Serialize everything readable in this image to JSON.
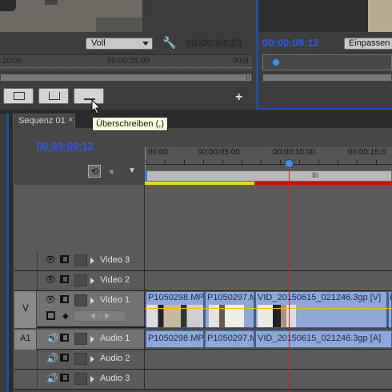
{
  "source_monitor": {
    "zoom_select": "Voll",
    "timecode": "00:00:04:23",
    "ruler_labels": [
      ":20:00",
      "00:00:25:00",
      "00:0"
    ]
  },
  "program_monitor": {
    "timecode": "00:00:09:12",
    "fit_select": "Einpassen"
  },
  "tooltip": "Überschreiben (,)",
  "sequence": {
    "tab_label": "Sequenz 01",
    "close_glyph": "×",
    "timecode": "00:00:09:12",
    "ruler_labels": [
      "00:00",
      "00:00:05:00",
      "00:00:10:00",
      "00:00:15:0"
    ],
    "work_area_marker": "III"
  },
  "tracks": {
    "video": [
      {
        "name": "Video 3"
      },
      {
        "name": "Video 2"
      },
      {
        "name": "Video 1",
        "target": "V"
      }
    ],
    "audio": [
      {
        "name": "Audio 1",
        "target": "A1"
      },
      {
        "name": "Audio 2"
      },
      {
        "name": "Audio 3"
      }
    ]
  },
  "clips": {
    "video": [
      "P1050298.MP4",
      "P1050297.M",
      "VID_20150615_021246.3gp [V]",
      "D"
    ],
    "audio": [
      "P1050298.MP4",
      "P1050297.M",
      "VID_20150615_021246.3gp [A]"
    ]
  },
  "colors": {
    "accent_timecode": "#2f57f0",
    "clip_fill": "#8fa8d8",
    "playhead": "#d02020",
    "render_bar_yellow": "#e8e000",
    "render_bar_red": "#d01010",
    "panel_bg": "#5b5b5b"
  },
  "icons": [
    "wrench-icon",
    "insert-icon",
    "lift-icon",
    "overwrite-icon",
    "add-icon",
    "snap-icon",
    "marker-icon",
    "eye-icon",
    "film-icon",
    "speaker-icon"
  ]
}
